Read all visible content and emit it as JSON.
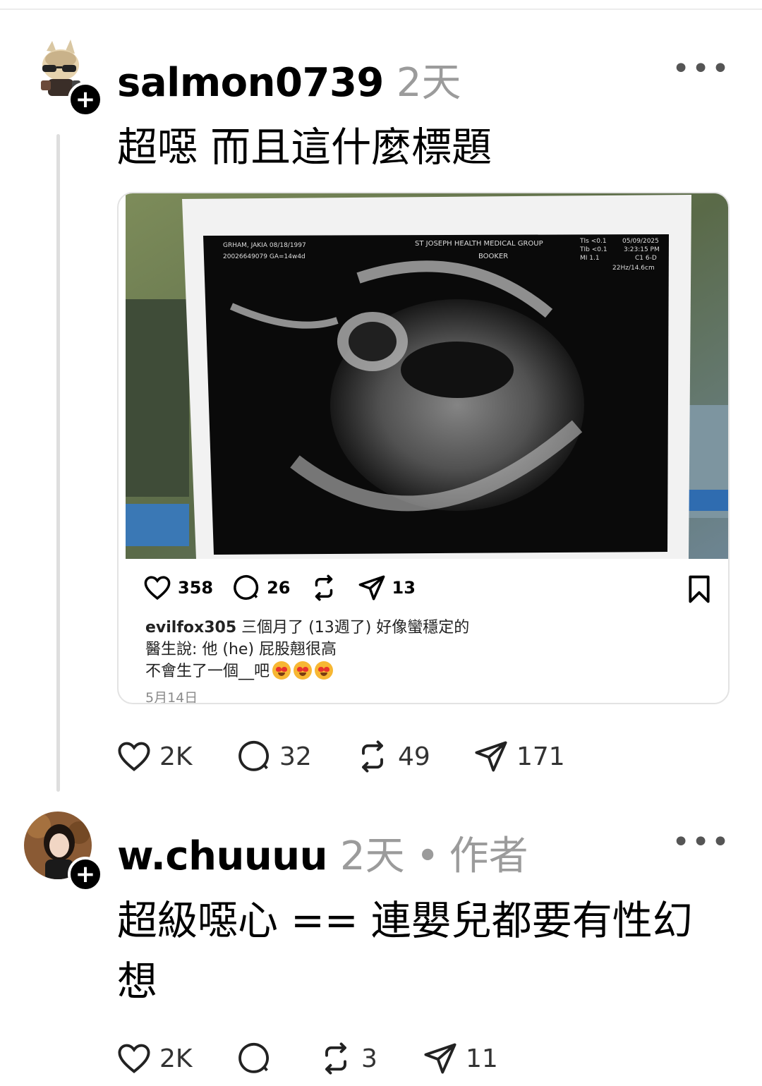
{
  "post1": {
    "username": "salmon0739",
    "time": "2天",
    "text": "超噁 而且這什麼標題",
    "more_icon": "more-icon",
    "embed": {
      "photo_overlay": {
        "patient": "GRHAM, JAKIA 08/18/1997",
        "ids": "20026649079 GA=14w4d",
        "clinic": "ST JOSEPH HEALTH MEDICAL GROUP",
        "booker": "BOOKER",
        "tis": "TIs <0.1",
        "tib": "TIb <0.1",
        "mi": "MI 1.1",
        "date": "05/09/2025",
        "clock": "3:23:15 PM",
        "probe": "C1 6-D",
        "freq": "22Hz/14.6cm"
      },
      "likes": "358",
      "comments": "26",
      "shares": "13",
      "caption_user": "evilfox305",
      "caption_line1": "三個月了 (13週了) 好像蠻穩定的",
      "caption_line2": "醫生說: 他 (he) 屁股翹很高",
      "caption_line3": "不會生了一個__吧",
      "date": "5月14日"
    },
    "likes": "2K",
    "comments": "32",
    "reposts": "49",
    "shares": "171"
  },
  "post2": {
    "username": "w.chuuuu",
    "time": "2天",
    "separator": "•",
    "role": "作者",
    "text": "超級噁心 == 連嬰兒都要有性幻想",
    "likes": "2K",
    "comments": "",
    "reposts": "3",
    "shares": "11"
  }
}
